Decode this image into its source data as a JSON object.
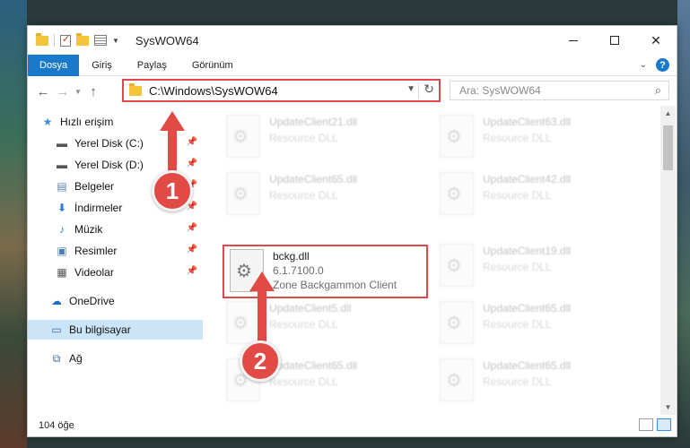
{
  "window": {
    "title": "SysWOW64"
  },
  "ribbon": {
    "tabs": [
      "Dosya",
      "Giriş",
      "Paylaş",
      "Görünüm"
    ]
  },
  "address_bar": {
    "path": "C:\\Windows\\SysWOW64"
  },
  "search": {
    "placeholder": "Ara: SysWOW64"
  },
  "nav_pane": {
    "items": [
      {
        "label": "Hızlı erişim",
        "icon": "star-icon"
      },
      {
        "label": "Yerel Disk (C:)",
        "icon": "drive-icon"
      },
      {
        "label": "Yerel Disk (D:)",
        "icon": "drive-icon"
      },
      {
        "label": "Belgeler",
        "icon": "document-icon"
      },
      {
        "label": "İndirmeler",
        "icon": "download-icon"
      },
      {
        "label": "Müzik",
        "icon": "music-icon"
      },
      {
        "label": "Resimler",
        "icon": "pictures-icon"
      },
      {
        "label": "Videolar",
        "icon": "video-icon"
      },
      {
        "label": "OneDrive",
        "icon": "cloud-icon"
      },
      {
        "label": "Bu bilgisayar",
        "icon": "computer-icon"
      },
      {
        "label": "Ağ",
        "icon": "network-icon"
      }
    ]
  },
  "files": [
    {
      "name": "UpdateClient21.dll",
      "desc": "Resource DLL",
      "blurred": true
    },
    {
      "name": "UpdateClient63.dll",
      "desc": "Resource DLL",
      "blurred": true
    },
    {
      "name": "UpdateClient65.dll",
      "desc": "Resource DLL",
      "blurred": true
    },
    {
      "name": "UpdateClient42.dll",
      "desc": "Resource DLL",
      "blurred": true
    },
    {
      "name": "bckg.dll",
      "version": "6.1.7100.0",
      "desc": "Zone Backgammon Client",
      "blurred": false
    },
    {
      "name": "UpdateClient19.dll",
      "desc": "Resource DLL",
      "blurred": true
    },
    {
      "name": "UpdateClient5.dll",
      "desc": "Resource DLL",
      "blurred": true
    },
    {
      "name": "UpdateClient65.dll",
      "desc": "Resource DLL",
      "blurred": true
    },
    {
      "name": "UpdateClient65.dll",
      "desc": "Resource DLL",
      "blurred": true
    },
    {
      "name": "UpdateClient65.dll",
      "desc": "Resource DLL",
      "blurred": true
    }
  ],
  "status": {
    "item_count": "104 öğe"
  },
  "annotations": {
    "step1": "1",
    "step2": "2",
    "color": "#e14a45"
  },
  "colors": {
    "accent": "#1979ca",
    "highlight_border": "#e0474c",
    "selected_bg": "#cce4f7"
  }
}
